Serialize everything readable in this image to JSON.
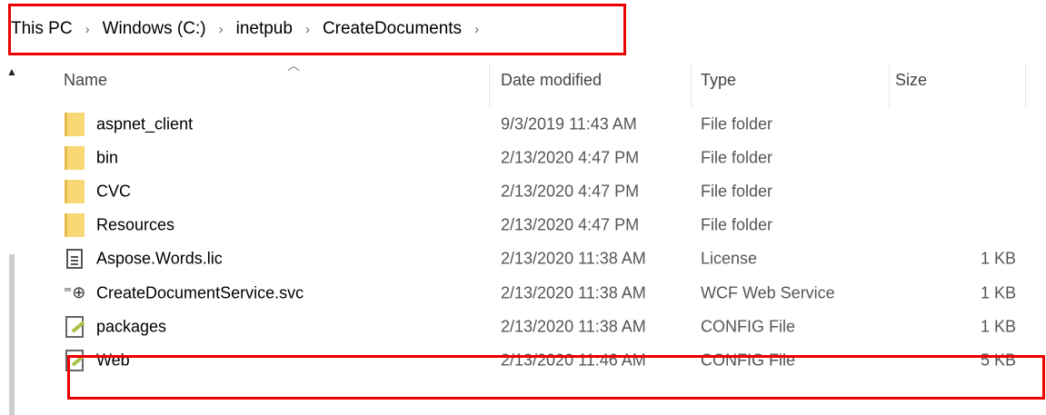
{
  "breadcrumb": [
    "This PC",
    "Windows (C:)",
    "inetpub",
    "CreateDocuments"
  ],
  "columns": {
    "name": "Name",
    "date": "Date modified",
    "type": "Type",
    "size": "Size"
  },
  "files": [
    {
      "icon": "folder-icon",
      "name": "aspnet_client",
      "date": "9/3/2019 11:43 AM",
      "type": "File folder",
      "size": ""
    },
    {
      "icon": "folder-icon",
      "name": "bin",
      "date": "2/13/2020 4:47 PM",
      "type": "File folder",
      "size": ""
    },
    {
      "icon": "folder-icon",
      "name": "CVC",
      "date": "2/13/2020 4:47 PM",
      "type": "File folder",
      "size": ""
    },
    {
      "icon": "folder-icon",
      "name": "Resources",
      "date": "2/13/2020 4:47 PM",
      "type": "File folder",
      "size": ""
    },
    {
      "icon": "document-icon",
      "name": "Aspose.Words.lic",
      "date": "2/13/2020 11:38 AM",
      "type": "License",
      "size": "1 KB"
    },
    {
      "icon": "web-service-icon",
      "name": "CreateDocumentService.svc",
      "date": "2/13/2020 11:38 AM",
      "type": "WCF Web Service",
      "size": "1 KB"
    },
    {
      "icon": "config-file-icon",
      "name": "packages",
      "date": "2/13/2020 11:38 AM",
      "type": "CONFIG File",
      "size": "1 KB"
    },
    {
      "icon": "config-file-icon",
      "name": "Web",
      "date": "2/13/2020 11:46 AM",
      "type": "CONFIG File",
      "size": "5 KB"
    }
  ],
  "colors": {
    "highlight_border": "#ee0000",
    "folder": "#f8d775"
  }
}
